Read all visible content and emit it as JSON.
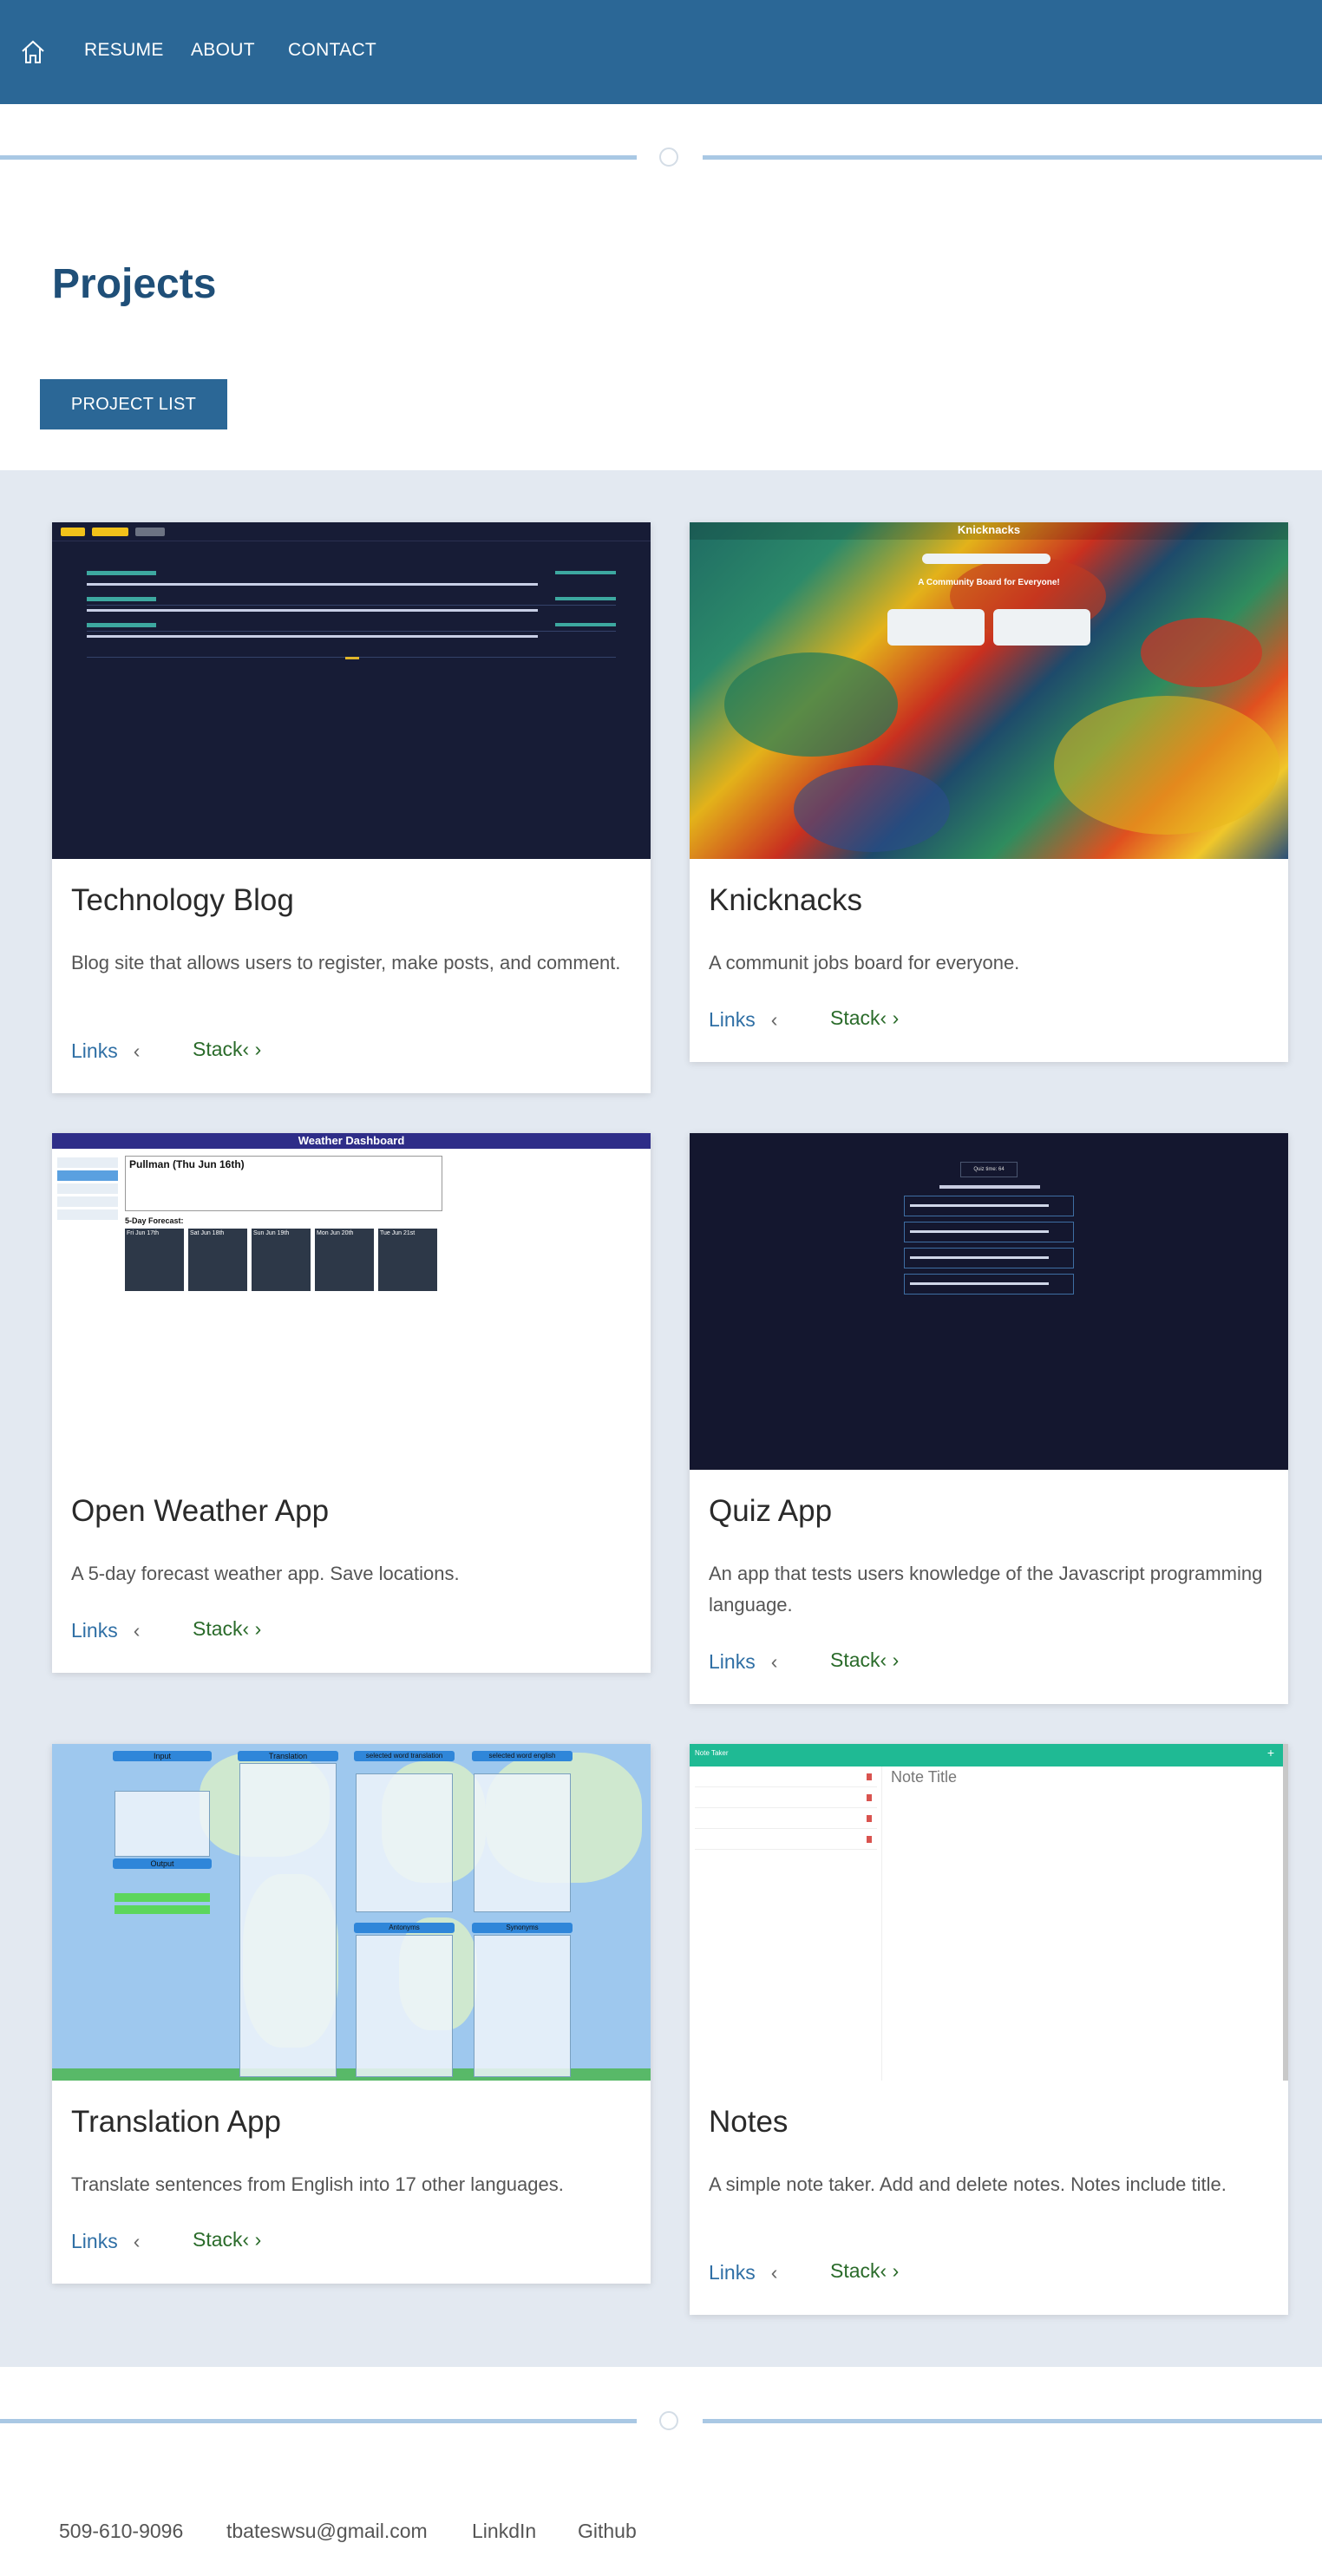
{
  "nav": {
    "home_icon": "home-icon",
    "links": [
      "RESUME",
      "ABOUT",
      "CONTACT"
    ]
  },
  "page": {
    "title": "Projects",
    "project_list_button": "PROJECT LIST"
  },
  "projects": [
    {
      "title": "Technology Blog",
      "description": "Blog site that allows users to register, make posts, and comment.",
      "links_label": "Links",
      "stack_label": "Stack"
    },
    {
      "title": "Knicknacks",
      "description": "A communit jobs board for everyone.",
      "links_label": "Links",
      "stack_label": "Stack"
    },
    {
      "title": "Open Weather App",
      "description": "A 5-day forecast weather app. Save locations.",
      "links_label": "Links",
      "stack_label": "Stack"
    },
    {
      "title": "Quiz App",
      "description": "An app that tests users knowledge of the Javascript programming language.",
      "links_label": "Links",
      "stack_label": "Stack"
    },
    {
      "title": "Translation App",
      "description": "Translate sentences from English into 17 other languages.",
      "links_label": "Links",
      "stack_label": "Stack"
    },
    {
      "title": "Notes",
      "description": "A simple note taker. Add and delete notes. Notes include title.",
      "links_label": "Links",
      "stack_label": "Stack"
    }
  ],
  "thumbnails": {
    "knicknacks_heading": "Knicknacks",
    "knicknacks_tagline": "A Community Board for Everyone!",
    "weather_header": "Weather Dashboard",
    "weather_city": "Pullman (Thu Jun 16th)",
    "weather_forecast_label": "5-Day Forecast:",
    "weather_days": [
      "Fri Jun 17th",
      "Sat Jun 18th",
      "Sun Jun 19th",
      "Mon Jun 20th",
      "Tue Jun 21st"
    ],
    "quiz_button": "Quiz time: 64",
    "translation_titles": [
      "Input",
      "Translation",
      "selected word translation",
      "selected word english",
      "Output",
      "Antonyms",
      "Synonyms"
    ],
    "notes_header": "Note Taker",
    "notes_title": "Note Title"
  },
  "footer": {
    "phone": "509-610-9096",
    "email": "tbateswsu@gmail.com",
    "linkedin": "LinkdIn",
    "github": "Github"
  }
}
